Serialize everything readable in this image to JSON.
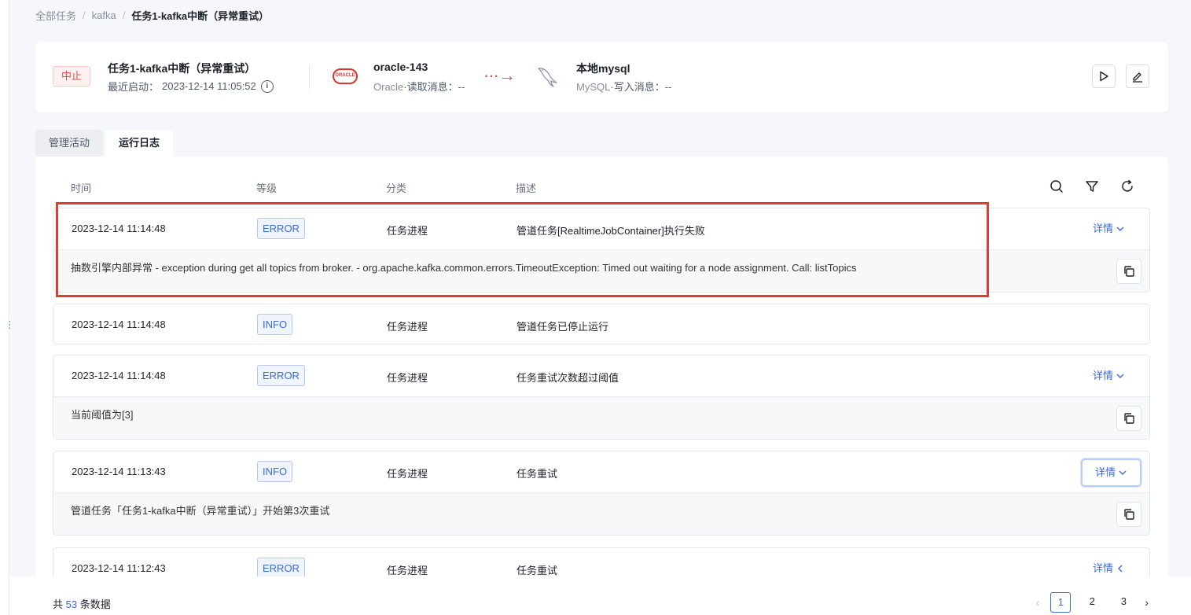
{
  "breadcrumb": {
    "all_tasks": "全部任务",
    "kafka": "kafka",
    "current": "任务1-kafka中断（异常重试）"
  },
  "task": {
    "status": "中止",
    "name": "任务1-kafka中断（异常重试）",
    "last_start_label": "最近启动：",
    "last_start_value": "2023-12-14 11:05:52",
    "info_icon": "i"
  },
  "source": {
    "logo_text": "ORACLE",
    "name": "oracle-143",
    "type": "Oracle",
    "sep": "·",
    "action": "读取消息：",
    "value": "--"
  },
  "flow_arrow": "···→",
  "destination": {
    "name": "本地mysql",
    "type": "MySQL",
    "sep": "·",
    "action": "写入消息：",
    "value": "--"
  },
  "tabs": {
    "manage": "管理活动",
    "logs": "运行日志"
  },
  "log_header": {
    "time": "时间",
    "level": "等级",
    "category": "分类",
    "description": "描述",
    "icons": [
      "search-icon",
      "filter-icon",
      "refresh-icon"
    ]
  },
  "detail_label": "详情",
  "logs": [
    {
      "time": "2023-12-14 11:14:48",
      "level": "ERROR",
      "category": "任务进程",
      "description": "管道任务[RealtimeJobContainer]执行失败",
      "detail": "抽数引擎内部异常 - exception during get all topics from broker. - org.apache.kafka.common.errors.TimeoutException: Timed out waiting for a node assignment. Call: listTopics"
    },
    {
      "time": "2023-12-14 11:14:48",
      "level": "INFO",
      "category": "任务进程",
      "description": "管道任务已停止运行"
    },
    {
      "time": "2023-12-14 11:14:48",
      "level": "ERROR",
      "category": "任务进程",
      "description": "任务重试次数超过阈值",
      "detail": "当前阈值为[3]"
    },
    {
      "time": "2023-12-14 11:13:43",
      "level": "INFO",
      "category": "任务进程",
      "description": "任务重试",
      "detail": "管道任务「任务1-kafka中断（异常重试）」开始第3次重试"
    },
    {
      "time": "2023-12-14 11:12:43",
      "level": "ERROR",
      "category": "任务进程",
      "description": "任务重试"
    }
  ],
  "pagination": {
    "prefix": "共",
    "total": "53",
    "suffix": "条数据",
    "pages": [
      "1",
      "2",
      "3"
    ],
    "current": "1"
  },
  "colors": {
    "accent": "#3a6bd8",
    "error": "#e24b4b",
    "highlight": "#e53935"
  }
}
